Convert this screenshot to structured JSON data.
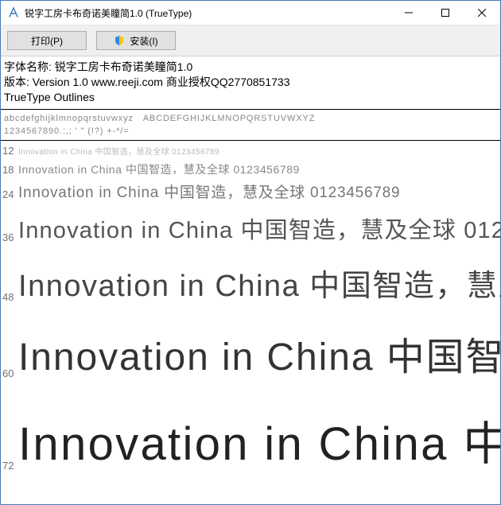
{
  "window": {
    "title": "锐字工房卡布奇诺美瞳简1.0 (TrueType)",
    "minimize": "–",
    "maximize": "☐",
    "close": "✕"
  },
  "toolbar": {
    "print_label": "打印(P)",
    "install_label": "安装(I)"
  },
  "meta": {
    "name_line": "字体名称: 锐字工房卡布奇诺美瞳简1.0",
    "version_line": "版本: Version 1.0 www.reeji.com 商业授权QQ2770851733",
    "outline_line": "TrueType Outlines"
  },
  "glyphs": {
    "lowercase": "abcdefghijklmnopqrstuvwxyz",
    "uppercase": "ABCDEFGHIJKLMNOPQRSTUVWXYZ",
    "digits": "1234567890.:,; ' \" (!?) +-*/="
  },
  "sample_text": "Innovation in China 中国智造，慧及全球 0123456789",
  "sizes": [
    "12",
    "18",
    "24",
    "36",
    "48",
    "60",
    "72"
  ]
}
